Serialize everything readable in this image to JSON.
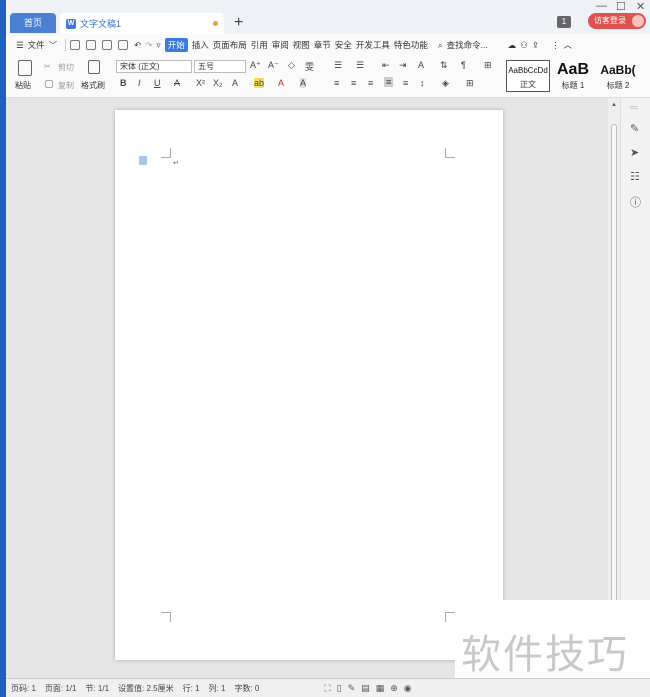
{
  "titlebar": {
    "home_tab": "首页",
    "doc_tab": "文字文稿1",
    "add_tab": "+",
    "window_badge": "1",
    "login": "访客登录",
    "minimize": "—",
    "maximize": "☐",
    "close": "✕"
  },
  "menubar": {
    "file": "文件",
    "tabs": [
      "开始",
      "插入",
      "页面布局",
      "引用",
      "审阅",
      "视图",
      "章节",
      "安全",
      "开发工具",
      "特色功能"
    ],
    "search": "查找命令..."
  },
  "ribbon": {
    "paste": "粘贴",
    "cut": "剪切",
    "copy": "复制",
    "format_painter": "格式刷",
    "font_name": "宋体 (正文)",
    "font_size": "五号",
    "styles": [
      {
        "preview": "AaBbCcDd",
        "caption": "正文"
      },
      {
        "preview": "AaB",
        "caption": "标题 1"
      },
      {
        "preview": "AaBb(",
        "caption": "标题 2"
      }
    ],
    "buttons": {
      "bold": "B",
      "italic": "I",
      "underline": "U",
      "grow_font": "A⁺",
      "shrink_font": "A⁻",
      "clear": "◇",
      "phonetic": "雯",
      "superscript": "X²",
      "subscript": "X₂",
      "font_color": "A",
      "char_shading": "A"
    }
  },
  "status": {
    "page_num": "页码: 1",
    "pages": "页面: 1/1",
    "section": "节: 1/1",
    "setting": "设置值: 2.5厘米",
    "row": "行: 1",
    "col": "列: 1",
    "words": "字数: 0"
  },
  "watermark": "软件技巧"
}
